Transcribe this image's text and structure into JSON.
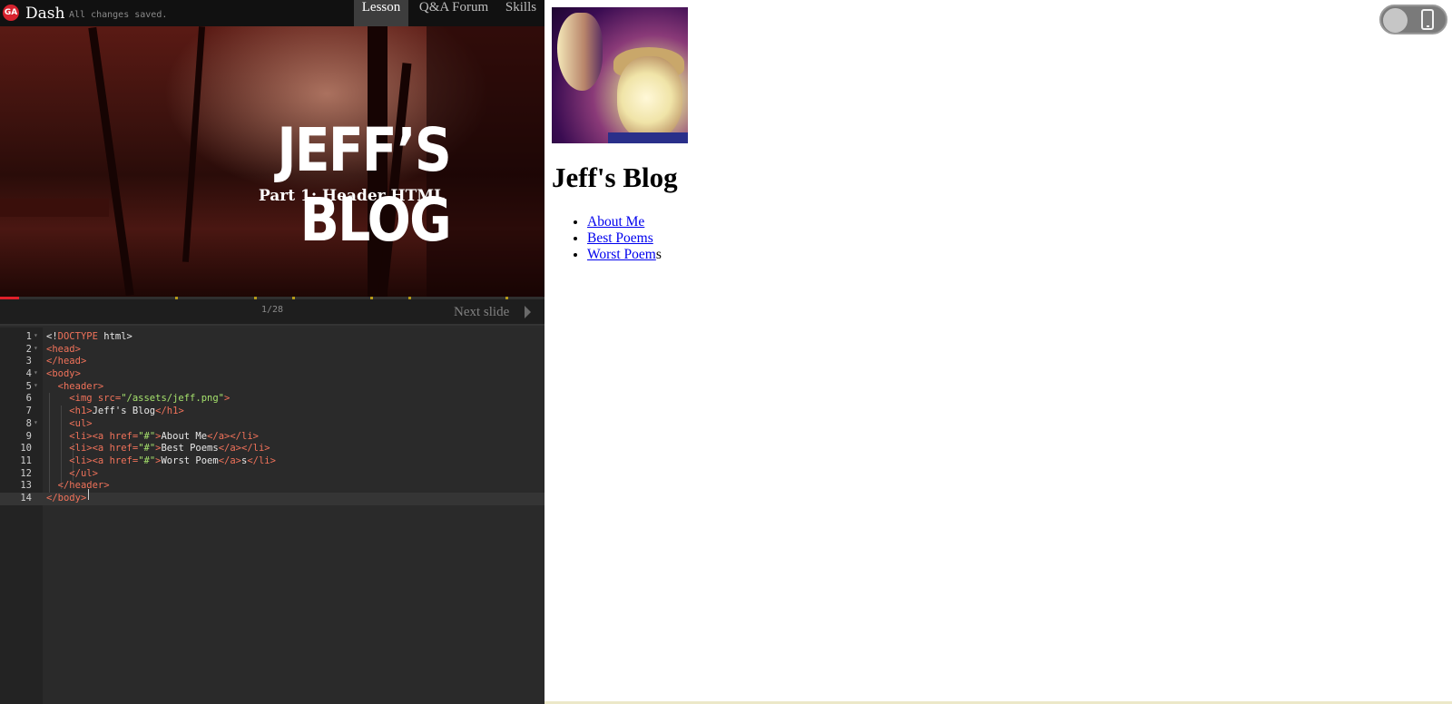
{
  "topbar": {
    "logo_text": "GA",
    "brand": "Dash",
    "status": "All changes saved.",
    "tabs": [
      {
        "label": "Lesson",
        "active": true
      },
      {
        "label": "Q&A Forum",
        "active": false
      },
      {
        "label": "Skills",
        "active": false
      }
    ]
  },
  "slide": {
    "title": "JEFF’S BLOG",
    "subtitle": "Part 1: Header HTML",
    "counter": "1/28",
    "next_label": "Next slide",
    "progress_fraction": 0.035,
    "accent_color": "#e0202a"
  },
  "editor": {
    "active_line": 14,
    "lines": [
      {
        "n": "1",
        "code": "<!DOCTYPE html>"
      },
      {
        "n": "2",
        "code": "<head>"
      },
      {
        "n": "3",
        "code": "</head>"
      },
      {
        "n": "4",
        "code": "<body>"
      },
      {
        "n": "5",
        "code": "  <header>"
      },
      {
        "n": "6",
        "code": "    <img src=\"/assets/jeff.png\">"
      },
      {
        "n": "7",
        "code": "    <h1>Jeff's Blog</h1>"
      },
      {
        "n": "8",
        "code": "    <ul>"
      },
      {
        "n": "9",
        "code": "    <li><a href=\"#\">About Me</a></li>"
      },
      {
        "n": "10",
        "code": "    <li><a href=\"#\">Best Poems</a></li>"
      },
      {
        "n": "11",
        "code": "    <li><a href=\"#\">Worst Poem</a>s</li>"
      },
      {
        "n": "12",
        "code": "    </ul>"
      },
      {
        "n": "13",
        "code": "  </header>"
      },
      {
        "n": "14",
        "code": "</body>"
      }
    ]
  },
  "preview": {
    "heading": "Jeff's Blog",
    "nav": [
      {
        "label": "About Me",
        "link_text": "About Me",
        "tail": ""
      },
      {
        "label": "Best Poems",
        "link_text": "Best Poems",
        "tail": ""
      },
      {
        "label": "Worst Poems",
        "link_text": "Worst Poem",
        "tail": "s"
      }
    ],
    "device_toggle_icon": "phone-icon"
  }
}
